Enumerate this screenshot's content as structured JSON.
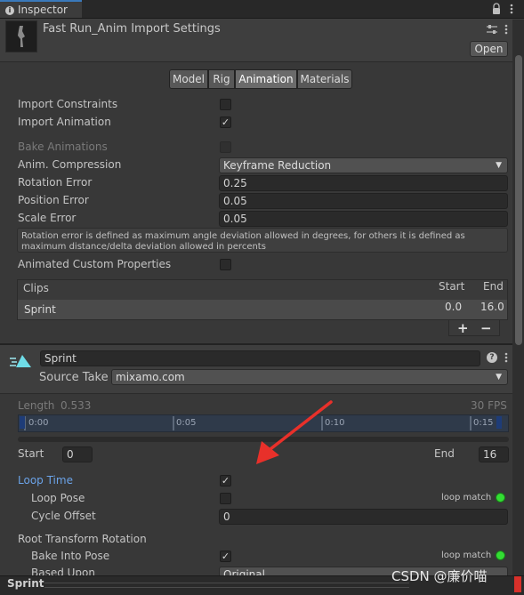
{
  "window": {
    "tab_label": "Inspector",
    "lock_icon": "lock-icon",
    "menu_icon": "kebab-menu-icon"
  },
  "header": {
    "title": "Fast Run_Anim Import Settings",
    "open_label": "Open"
  },
  "tabs": [
    "Model",
    "Rig",
    "Animation",
    "Materials"
  ],
  "active_tab": "Animation",
  "import": {
    "constraints_label": "Import Constraints",
    "constraints_checked": false,
    "animation_label": "Import Animation",
    "animation_checked": true,
    "bake_label": "Bake Animations",
    "bake_checked": false,
    "compression_label": "Anim. Compression",
    "compression_value": "Keyframe Reduction",
    "rotation_error_label": "Rotation Error",
    "rotation_error_value": "0.25",
    "position_error_label": "Position Error",
    "position_error_value": "0.05",
    "scale_error_label": "Scale Error",
    "scale_error_value": "0.05",
    "help_text": "Rotation error is defined as maximum angle deviation allowed in degrees, for others it is defined as maximum distance/delta deviation allowed in percents",
    "custom_props_label": "Animated Custom Properties",
    "custom_props_checked": false
  },
  "clips": {
    "header": "Clips",
    "start_header": "Start",
    "end_header": "End",
    "rows": [
      {
        "name": "Sprint",
        "start": "0.0",
        "end": "16.0"
      }
    ],
    "add_label": "+",
    "remove_label": "−"
  },
  "clip": {
    "name": "Sprint",
    "source_take_label": "Source Take",
    "source_take_value": "mixamo.com",
    "length_label": "Length",
    "length_value": "0.533",
    "fps": "30 FPS",
    "ticks": [
      "0:00",
      "0:05",
      "0:10",
      "0:15"
    ],
    "start_label": "Start",
    "start_value": "0",
    "end_label": "End",
    "end_value": "16",
    "loop_time_label": "Loop Time",
    "loop_time_checked": true,
    "loop_pose_label": "Loop Pose",
    "loop_pose_checked": false,
    "loop_match_label": "loop match",
    "cycle_offset_label": "Cycle Offset",
    "cycle_offset_value": "0",
    "root_rotation_label": "Root Transform Rotation",
    "bake_into_pose_label": "Bake Into Pose",
    "bake_into_pose_checked": true,
    "based_upon_label": "Based Upon",
    "based_upon_value": "Original"
  },
  "status": {
    "label": "Sprint"
  },
  "watermark": "CSDN @廉价喵",
  "colors": {
    "accent_blue": "#3a79bb",
    "loop_time_blue": "#6ba3e8",
    "match_green": "#33dd33",
    "arrow_red": "#e8302a"
  }
}
